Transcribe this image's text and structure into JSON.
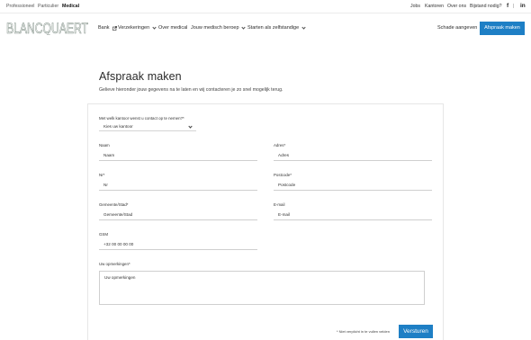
{
  "segments": [
    {
      "label": "Professioneel",
      "active": false
    },
    {
      "label": "Particulier",
      "active": false
    },
    {
      "label": "Medical",
      "active": true
    }
  ],
  "utility_links": [
    "Jobs",
    "Kantoren",
    "Over ons",
    "Bijstand nodig?"
  ],
  "social": {
    "facebook_glyph": "f",
    "separator": "|",
    "linkedin_glyph": "in"
  },
  "logo": {
    "text": "BLANCQUAERT"
  },
  "nav": {
    "items": [
      {
        "label": "Bank",
        "icon": "external-link-icon"
      },
      {
        "label": "Verzekeringen",
        "icon": "chevron-down-icon"
      },
      {
        "label": "Over medical",
        "icon": ""
      },
      {
        "label": "Jouw medisch beroep",
        "icon": "chevron-down-icon"
      },
      {
        "label": "Starten als zelfstandige",
        "icon": "chevron-down-icon"
      }
    ],
    "damage_link": "Schade aangeven",
    "cta_label": "Afspraak maken"
  },
  "page": {
    "title": "Afspraak maken",
    "intro": "Gelieve hieronder jouw gegevens na te laten en wij contacteren je zo snel mogelijk terug."
  },
  "form": {
    "office": {
      "label": "Met welk kantoor wenst u contact op te nemen?*",
      "value": "Kies uw kantoor"
    },
    "naam": {
      "label": "Naam",
      "placeholder": "Naam"
    },
    "adres": {
      "label": "Adres*",
      "placeholder": "Adres"
    },
    "nr": {
      "label": "Nr*",
      "placeholder": "Nr"
    },
    "postcode": {
      "label": "Postcode*",
      "placeholder": "Postcode"
    },
    "gemeente": {
      "label": "Gemeente/Stad*",
      "placeholder": "Gemeente/Stad"
    },
    "email": {
      "label": "E-mail",
      "placeholder": "E-mail"
    },
    "gsm": {
      "label": "GSM",
      "placeholder": "+32 00 00 00 00"
    },
    "opmerkingen": {
      "label": "Uw opmerkingen*",
      "placeholder": "Uw opmerkingen"
    },
    "required_note": "* Niet verplicht in te vullen velden",
    "submit_label": "Versturen"
  },
  "colors": {
    "accent": "#1e7fc5",
    "text": "#2b2b2b",
    "logo": "#7a8a80"
  }
}
